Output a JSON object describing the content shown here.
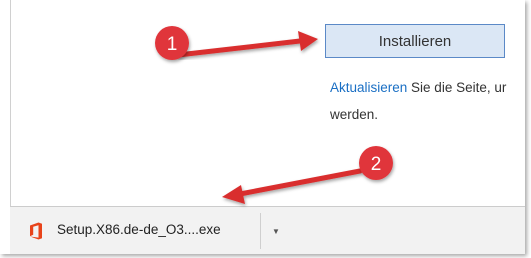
{
  "page": {
    "install_button_label": "Installieren",
    "update_link_text": "Aktualisieren",
    "update_text_rest": " Sie die Seite, ur",
    "second_line_text": "werden."
  },
  "download_bar": {
    "file_name": "Setup.X86.de-de_O3....exe",
    "file_icon": "office-icon",
    "menu_icon": "chevron-down-icon"
  },
  "annotations": {
    "badge_1": "1",
    "badge_2": "2",
    "badge_color": "#e0353b",
    "arrow_color": "#d92e2e"
  }
}
